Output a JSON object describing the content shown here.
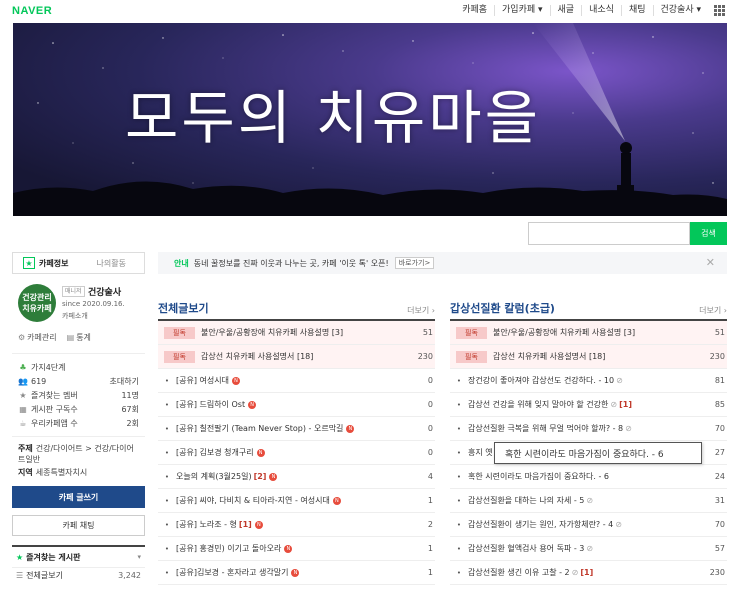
{
  "brand": "NAVER",
  "topnav": [
    "카페홈",
    "가입카페 ▾",
    "새글",
    "내소식",
    "채팅",
    "건강술사 ▾"
  ],
  "banner": {
    "title": "모두의 치유마을"
  },
  "search": {
    "placeholder": "",
    "button": "검색"
  },
  "sidebar": {
    "tabs": [
      "카페정보",
      "나의활동"
    ],
    "avatar_text": "건강관리\n치유카페",
    "manager_badge": "매니저",
    "manager_name": "건강술사",
    "since": "since 2020.09.16.",
    "cafe_intro": "카페소개",
    "manage": [
      "카페관리",
      "통계"
    ],
    "stats": [
      {
        "icon": "leaf-icon",
        "label": "가지4단계",
        "value": ""
      },
      {
        "icon": "members-icon",
        "label": "619",
        "value": "초대하기"
      },
      {
        "icon": "star-icon",
        "label": "즐겨찾는 멤버",
        "value": "11명"
      },
      {
        "icon": "board-icon",
        "label": "게시판 구독수",
        "value": "67회"
      },
      {
        "icon": "cafe-icon",
        "label": "우리카페앱 수",
        "value": "2회"
      }
    ],
    "topic_label": "주제",
    "topic": "건강/다이어트 > 건강/다이어트일반",
    "region_label": "지역",
    "region": "세종특별자치시",
    "write_button": "카페 글쓰기",
    "chat_button": "카페 채팅",
    "fav_title": "즐겨찾는 게시판",
    "fav_items": [
      {
        "label": "전체글보기",
        "count": "3,242"
      }
    ]
  },
  "notice": {
    "tag": "안내",
    "text": "동네 꿀정보를 진짜 이웃과 나누는 곳, 카페 '이웃 톡' 오픈!",
    "go": "바로가기>"
  },
  "board_left": {
    "title": "전체글보기",
    "more": "더보기 ›",
    "pinned": [
      {
        "badge": "필독",
        "title": "불안/우울/공황장애 치유카페 사용설명 [3]",
        "count": "51"
      },
      {
        "badge": "필독",
        "title": "갑상선 치유카페 사용설명서 [18]",
        "count": "230"
      }
    ],
    "rows": [
      {
        "title": "[공유] 여성시대",
        "cc": "",
        "new": "N",
        "count": "0"
      },
      {
        "title": "[공유] 드림하이 Ost",
        "cc": "",
        "new": "N",
        "count": "0"
      },
      {
        "title": "[공유] 칠전팔기 (Team Never Stop) - 오르막길",
        "cc": "",
        "new": "N",
        "count": "0"
      },
      {
        "title": "[공유] 김보경 청개구리",
        "cc": "",
        "new": "N",
        "count": "0"
      },
      {
        "title": "오늘의 계획(3월25일)",
        "cc": "[2]",
        "new": "N",
        "count": "4"
      },
      {
        "title": "[공유] 씨야, 다비치 & 티아라-지연 - 여성시대",
        "cc": "",
        "new": "N",
        "count": "1"
      },
      {
        "title": "[공유] 노라조 - 형",
        "cc": "[1]",
        "new": "N",
        "count": "2"
      },
      {
        "title": "[공유] 홍경민) 이기고 돌아오라",
        "cc": "",
        "new": "N",
        "count": "1"
      },
      {
        "title": "[공유]김보경 - 혼자라고 생각말기",
        "cc": "",
        "new": "N",
        "count": "1"
      }
    ]
  },
  "board_right": {
    "title": "갑상선질환 칼럼(초급)",
    "more": "더보기 ›",
    "pinned": [
      {
        "badge": "필독",
        "title": "불안/우울/공황장애 치유카페 사용설명 [3]",
        "count": "51"
      },
      {
        "badge": "필독",
        "title": "갑상선 치유카페 사용설명서 [18]",
        "count": "230"
      }
    ],
    "rows": [
      {
        "title": "장건강이 좋아져야 갑상선도 건강하다. - 10",
        "att": "⊘",
        "cc": "",
        "count": "81"
      },
      {
        "title": "갑상선 건강을 위해 잊지 말아야 할 건강한",
        "att": "⊘",
        "cc": "[1]",
        "count": "85"
      },
      {
        "title": "갑상선질환 극복을 위해 무얼 먹어야 할까? - 8",
        "att": "⊘",
        "cc": "",
        "count": "70"
      },
      {
        "title": "흥지 옛",
        "att": "",
        "cc": "",
        "count": "27"
      },
      {
        "title": "혹한 시련이라도 마음가짐이 중요하다. - 6",
        "att": "",
        "cc": "",
        "count": "24"
      },
      {
        "title": "갑상선질환을 대하는 나의 자세 - 5",
        "att": "⊘",
        "cc": "",
        "count": "31"
      },
      {
        "title": "갑상선질환이 생기는 원인, 자가항체란? - 4",
        "att": "⊘",
        "cc": "",
        "count": "70"
      },
      {
        "title": "갑상선질환 혈액검사 용어 독파 - 3",
        "att": "⊘",
        "cc": "",
        "count": "57"
      },
      {
        "title": "갑상선질환 생긴 이유 고찰 - 2",
        "att": "⊘",
        "cc": "[1]",
        "count": "230"
      }
    ]
  },
  "tooltip": "혹한 시련이라도 마음가짐이 중요하다. - 6",
  "colors": {
    "naver_green": "#03c75a",
    "board_title": "#1f4a8a",
    "pinned_red": "#c0392b"
  }
}
